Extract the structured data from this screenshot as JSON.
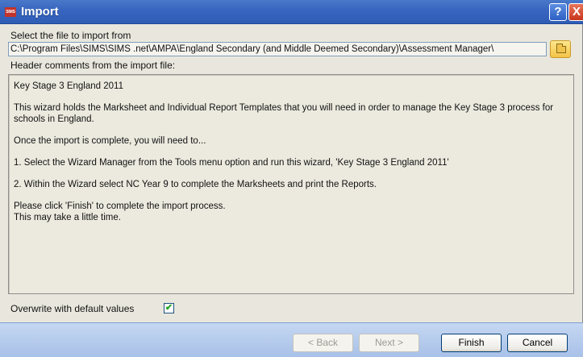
{
  "window": {
    "logo_text": "SIMS",
    "title": "Import",
    "help_label": "?",
    "close_label": "X"
  },
  "file": {
    "label": "Select the file to import from",
    "path": "C:\\Program Files\\SIMS\\SIMS .net\\AMPA\\England Secondary (and Middle Deemed Secondary)\\Assessment Manager\\"
  },
  "header": {
    "label": "Header comments from the import file:",
    "paragraphs": [
      "Key Stage 3 England 2011",
      "This wizard holds the Marksheet and Individual Report Templates that you will need in order to manage the Key Stage 3 process for schools in England.",
      "Once the import is complete, you will need to...",
      "1.  Select the Wizard Manager from the Tools menu option and run this wizard, 'Key Stage 3 England 2011'",
      "2.  Within the Wizard select NC Year 9 to complete the Marksheets and print the Reports.",
      "Please click 'Finish' to complete the import process.",
      "This may take a little time."
    ]
  },
  "overwrite": {
    "label": "Overwrite with default values",
    "checked": true,
    "check_glyph": "✔"
  },
  "buttons": {
    "back": "< Back",
    "next": "Next >",
    "finish": "Finish",
    "cancel": "Cancel"
  },
  "icons": {
    "browse": "folder-icon",
    "help": "help-icon",
    "close": "close-icon"
  }
}
